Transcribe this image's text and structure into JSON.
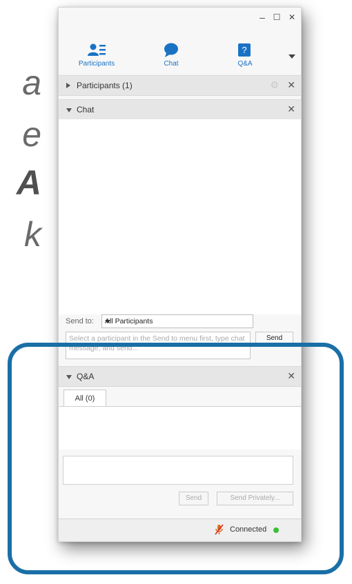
{
  "background_letters": [
    "a",
    "e",
    "A",
    "k"
  ],
  "window": {
    "controls": {
      "minimize": "–",
      "maximize": "☐",
      "close": "✕"
    }
  },
  "toolbar": {
    "participants_label": "Participants",
    "chat_label": "Chat",
    "qa_label": "Q&A",
    "accent_color": "#1a72c4"
  },
  "panels": {
    "participants": {
      "title": "Participants (1)",
      "expanded": false
    },
    "chat": {
      "title": "Chat",
      "expanded": true
    },
    "qa": {
      "title": "Q&A",
      "expanded": true
    }
  },
  "chat": {
    "send_to_label": "Send to:",
    "send_to_value": "All Participants",
    "input_placeholder": "Select a participant in the Send to menu first, type chat message, and send...",
    "send_button": "Send"
  },
  "qa": {
    "tabs": [
      {
        "label": "All (0)",
        "selected": true
      }
    ],
    "send_button": "Send",
    "send_privately_button": "Send Privately..."
  },
  "status": {
    "text": "Connected",
    "indicator_color": "#3bbf39"
  },
  "highlight_color": "#1a6fa6"
}
